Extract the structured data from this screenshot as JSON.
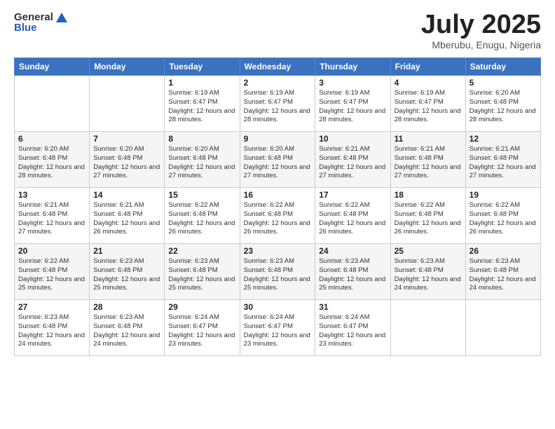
{
  "logo": {
    "general": "General",
    "blue": "Blue"
  },
  "header": {
    "month": "July 2025",
    "location": "Mberubu, Enugu, Nigeria"
  },
  "weekdays": [
    "Sunday",
    "Monday",
    "Tuesday",
    "Wednesday",
    "Thursday",
    "Friday",
    "Saturday"
  ],
  "weeks": [
    [
      {
        "day": "",
        "info": ""
      },
      {
        "day": "",
        "info": ""
      },
      {
        "day": "1",
        "info": "Sunrise: 6:19 AM\nSunset: 6:47 PM\nDaylight: 12 hours and 28 minutes."
      },
      {
        "day": "2",
        "info": "Sunrise: 6:19 AM\nSunset: 6:47 PM\nDaylight: 12 hours and 28 minutes."
      },
      {
        "day": "3",
        "info": "Sunrise: 6:19 AM\nSunset: 6:47 PM\nDaylight: 12 hours and 28 minutes."
      },
      {
        "day": "4",
        "info": "Sunrise: 6:19 AM\nSunset: 6:47 PM\nDaylight: 12 hours and 28 minutes."
      },
      {
        "day": "5",
        "info": "Sunrise: 6:20 AM\nSunset: 6:48 PM\nDaylight: 12 hours and 28 minutes."
      }
    ],
    [
      {
        "day": "6",
        "info": "Sunrise: 6:20 AM\nSunset: 6:48 PM\nDaylight: 12 hours and 28 minutes."
      },
      {
        "day": "7",
        "info": "Sunrise: 6:20 AM\nSunset: 6:48 PM\nDaylight: 12 hours and 27 minutes."
      },
      {
        "day": "8",
        "info": "Sunrise: 6:20 AM\nSunset: 6:48 PM\nDaylight: 12 hours and 27 minutes."
      },
      {
        "day": "9",
        "info": "Sunrise: 6:20 AM\nSunset: 6:48 PM\nDaylight: 12 hours and 27 minutes."
      },
      {
        "day": "10",
        "info": "Sunrise: 6:21 AM\nSunset: 6:48 PM\nDaylight: 12 hours and 27 minutes."
      },
      {
        "day": "11",
        "info": "Sunrise: 6:21 AM\nSunset: 6:48 PM\nDaylight: 12 hours and 27 minutes."
      },
      {
        "day": "12",
        "info": "Sunrise: 6:21 AM\nSunset: 6:48 PM\nDaylight: 12 hours and 27 minutes."
      }
    ],
    [
      {
        "day": "13",
        "info": "Sunrise: 6:21 AM\nSunset: 6:48 PM\nDaylight: 12 hours and 27 minutes."
      },
      {
        "day": "14",
        "info": "Sunrise: 6:21 AM\nSunset: 6:48 PM\nDaylight: 12 hours and 26 minutes."
      },
      {
        "day": "15",
        "info": "Sunrise: 6:22 AM\nSunset: 6:48 PM\nDaylight: 12 hours and 26 minutes."
      },
      {
        "day": "16",
        "info": "Sunrise: 6:22 AM\nSunset: 6:48 PM\nDaylight: 12 hours and 26 minutes."
      },
      {
        "day": "17",
        "info": "Sunrise: 6:22 AM\nSunset: 6:48 PM\nDaylight: 12 hours and 26 minutes."
      },
      {
        "day": "18",
        "info": "Sunrise: 6:22 AM\nSunset: 6:48 PM\nDaylight: 12 hours and 26 minutes."
      },
      {
        "day": "19",
        "info": "Sunrise: 6:22 AM\nSunset: 6:48 PM\nDaylight: 12 hours and 26 minutes."
      }
    ],
    [
      {
        "day": "20",
        "info": "Sunrise: 6:22 AM\nSunset: 6:48 PM\nDaylight: 12 hours and 25 minutes."
      },
      {
        "day": "21",
        "info": "Sunrise: 6:23 AM\nSunset: 6:48 PM\nDaylight: 12 hours and 25 minutes."
      },
      {
        "day": "22",
        "info": "Sunrise: 6:23 AM\nSunset: 6:48 PM\nDaylight: 12 hours and 25 minutes."
      },
      {
        "day": "23",
        "info": "Sunrise: 6:23 AM\nSunset: 6:48 PM\nDaylight: 12 hours and 25 minutes."
      },
      {
        "day": "24",
        "info": "Sunrise: 6:23 AM\nSunset: 6:48 PM\nDaylight: 12 hours and 25 minutes."
      },
      {
        "day": "25",
        "info": "Sunrise: 6:23 AM\nSunset: 6:48 PM\nDaylight: 12 hours and 24 minutes."
      },
      {
        "day": "26",
        "info": "Sunrise: 6:23 AM\nSunset: 6:48 PM\nDaylight: 12 hours and 24 minutes."
      }
    ],
    [
      {
        "day": "27",
        "info": "Sunrise: 6:23 AM\nSunset: 6:48 PM\nDaylight: 12 hours and 24 minutes."
      },
      {
        "day": "28",
        "info": "Sunrise: 6:23 AM\nSunset: 6:48 PM\nDaylight: 12 hours and 24 minutes."
      },
      {
        "day": "29",
        "info": "Sunrise: 6:24 AM\nSunset: 6:47 PM\nDaylight: 12 hours and 23 minutes."
      },
      {
        "day": "30",
        "info": "Sunrise: 6:24 AM\nSunset: 6:47 PM\nDaylight: 12 hours and 23 minutes."
      },
      {
        "day": "31",
        "info": "Sunrise: 6:24 AM\nSunset: 6:47 PM\nDaylight: 12 hours and 23 minutes."
      },
      {
        "day": "",
        "info": ""
      },
      {
        "day": "",
        "info": ""
      }
    ]
  ]
}
